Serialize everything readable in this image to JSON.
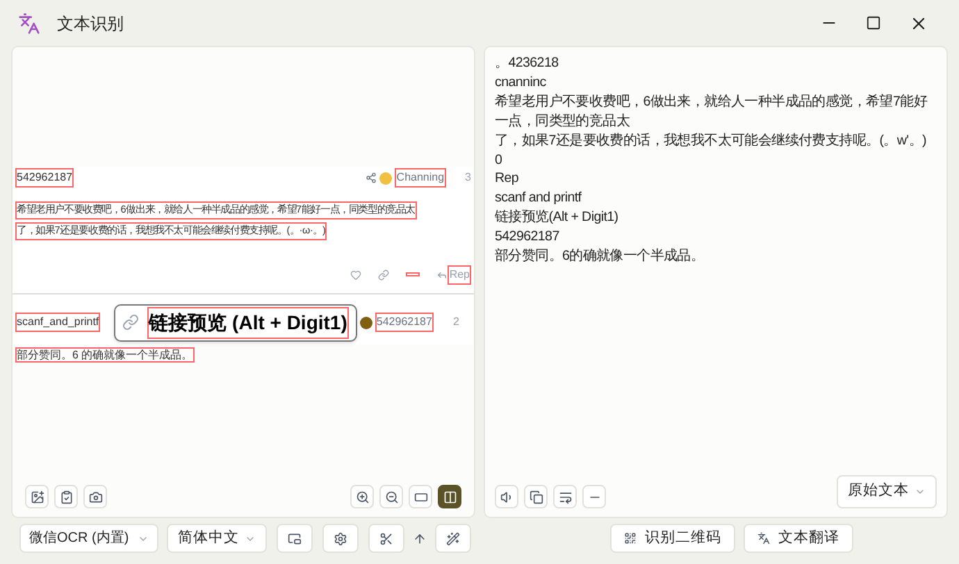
{
  "window": {
    "title": "文本识别"
  },
  "capture": {
    "post1": {
      "user": "542962187",
      "author": "Channing",
      "count": "3",
      "lines": [
        "希望老用户不要收费吧，6做出来，就给人一种半成品的感觉，希望7能好一点，同类型的竞品太",
        "了，如果7还是要收费的话，我想我不太可能会继续付费支持呢。(。·ω·。)"
      ],
      "reply": "Rep"
    },
    "post2": {
      "user": "scanf_and_printf",
      "tooltip": "链接预览 (Alt + Digit1)",
      "author": "542962187",
      "count": "2",
      "text": "部分赞同。6 的确就像一个半成品。"
    }
  },
  "image_tools": [
    {
      "kind": "left",
      "selected": false
    },
    {
      "kind": "left",
      "selected": false
    },
    {
      "kind": "left",
      "selected": false
    },
    {
      "kind": "right",
      "selected": false
    },
    {
      "kind": "right",
      "selected": false
    },
    {
      "kind": "right",
      "selected": false
    },
    {
      "kind": "right",
      "selected": true
    }
  ],
  "result_lines": [
    "。4236218",
    "cnanninc",
    "希望老用户不要收费吧，6做出来，就给人一种半成品的感觉，希望7能好一点，同类型的竞品太",
    "了，如果7还是要收费的话，我想我不太可能会继续付费支持呢。(。w'。)",
    "0",
    "Rep",
    "scanf and printf",
    "链接预览(Alt + Digit1)",
    "542962187",
    "部分赞同。6的确就像一个半成品。"
  ],
  "result_mode": "原始文本",
  "engine": "微信OCR (内置)",
  "language": "简体中文",
  "actions": [
    "识别二维码",
    "文本翻译"
  ]
}
